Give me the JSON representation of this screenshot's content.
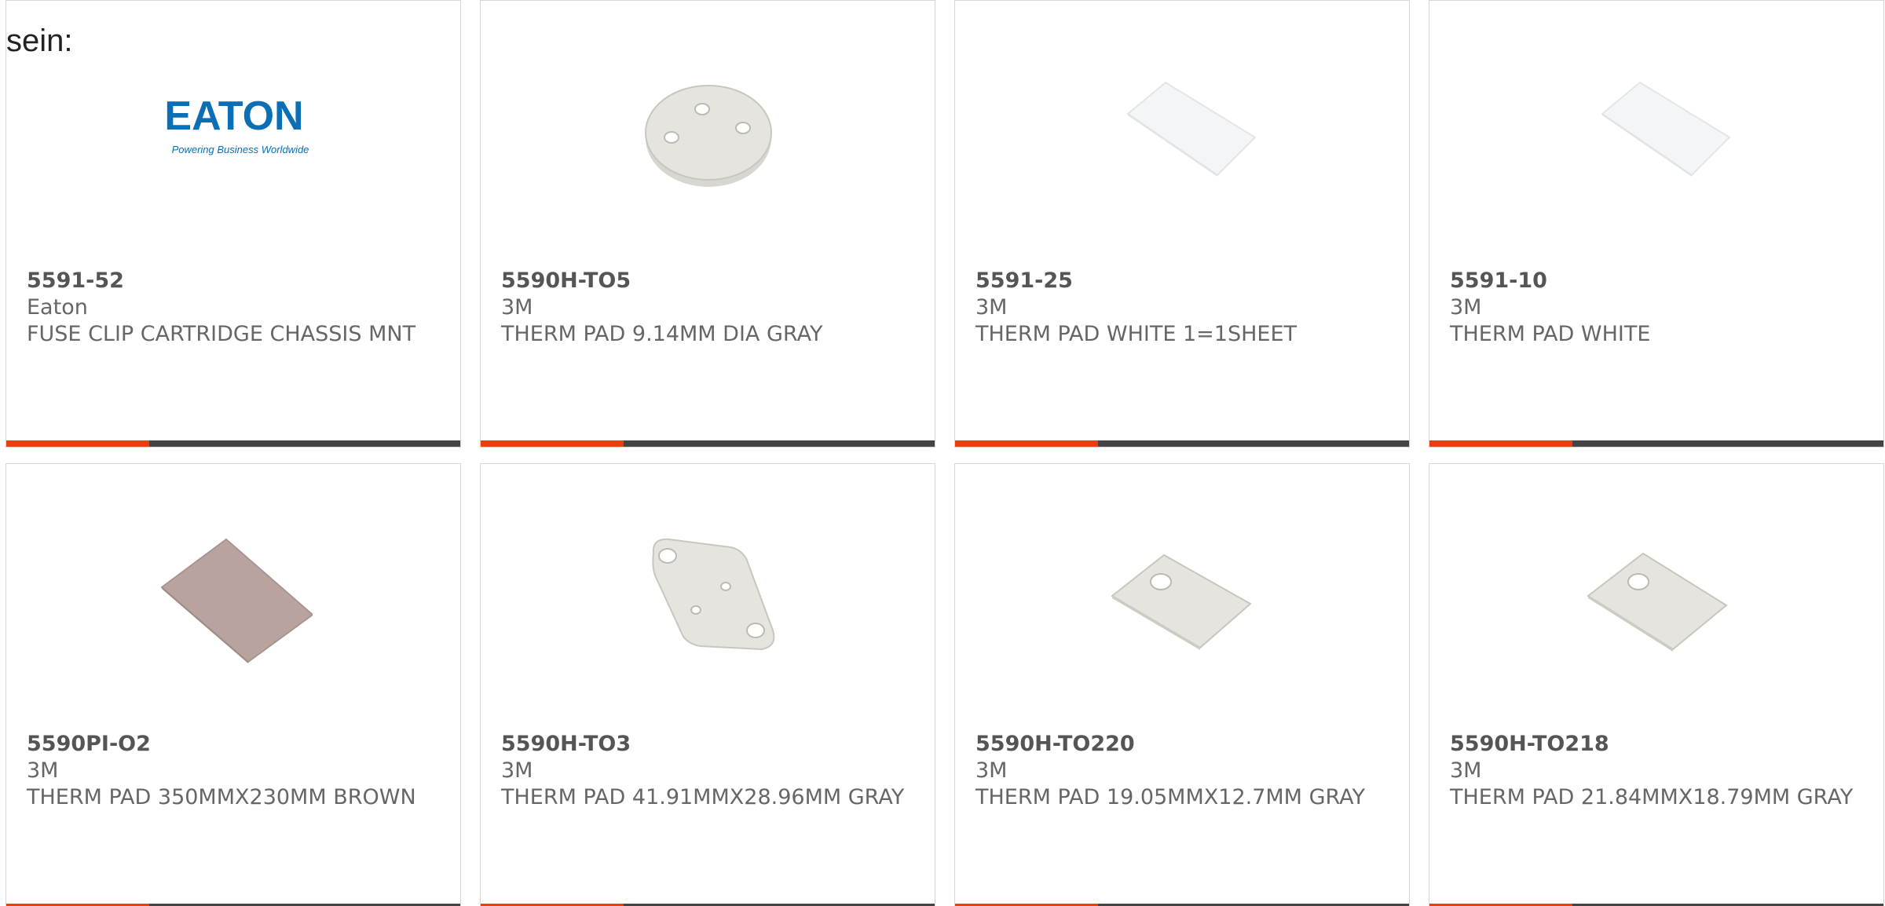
{
  "intro_text": "sein:",
  "colors": {
    "accent": "#e84010",
    "bar": "#444444",
    "eaton_blue": "#0a6fb5"
  },
  "products": [
    {
      "part_number": "5591-52",
      "manufacturer": "Eaton",
      "description": "FUSE CLIP CARTRIDGE CHASSIS MNT",
      "image": "eaton-logo",
      "logo_word": "EATON",
      "logo_tagline": "Powering Business Worldwide"
    },
    {
      "part_number": "5590H-TO5",
      "manufacturer": "3M",
      "description": "THERM PAD 9.14MM DIA GRAY",
      "image": "round-gray-pad"
    },
    {
      "part_number": "5591-25",
      "manufacturer": "3M",
      "description": "THERM PAD WHITE 1=1SHEET",
      "image": "white-sheet-pad"
    },
    {
      "part_number": "5591-10",
      "manufacturer": "3M",
      "description": "THERM PAD WHITE",
      "image": "white-sheet-pad"
    },
    {
      "part_number": "5590PI-O2",
      "manufacturer": "3M",
      "description": "THERM PAD 350MMX230MM BROWN",
      "image": "brown-sheet-pad"
    },
    {
      "part_number": "5590H-TO3",
      "manufacturer": "3M",
      "description": "THERM PAD 41.91MMX28.96MM GRAY",
      "image": "to3-gray-pad"
    },
    {
      "part_number": "5590H-TO220",
      "manufacturer": "3M",
      "description": "THERM PAD 19.05MMX12.7MM GRAY",
      "image": "rect-gray-pad"
    },
    {
      "part_number": "5590H-TO218",
      "manufacturer": "3M",
      "description": "THERM PAD 21.84MMX18.79MM GRAY",
      "image": "rect-gray-pad"
    }
  ]
}
